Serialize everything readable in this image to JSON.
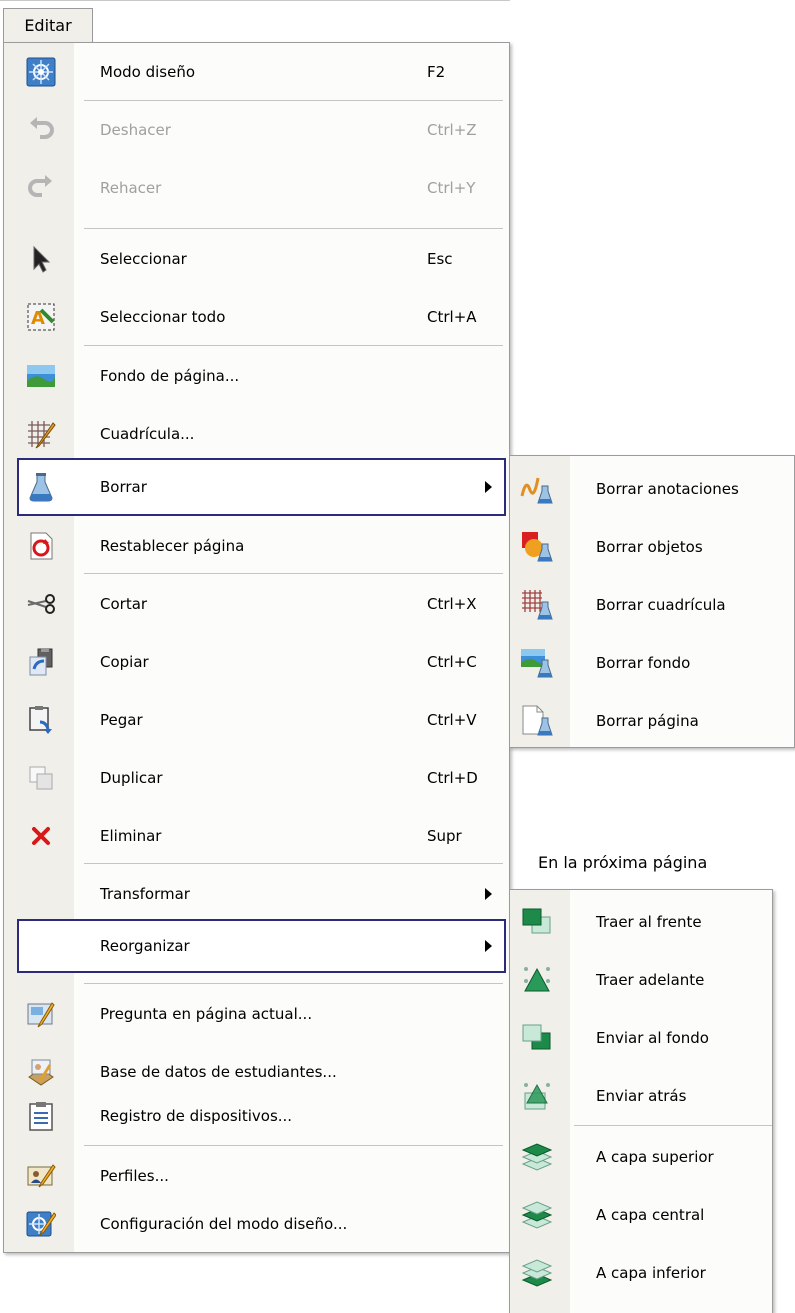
{
  "menubar": {
    "title": "Editar"
  },
  "main_menu": {
    "items": [
      {
        "label": "Modo diseño",
        "shortcut": "F2",
        "icon": "design-mode-icon"
      },
      {
        "label": "Deshacer",
        "shortcut": "Ctrl+Z",
        "icon": "undo-icon"
      },
      {
        "label": "Rehacer",
        "shortcut": "Ctrl+Y",
        "icon": "redo-icon"
      },
      {
        "label": "Seleccionar",
        "shortcut": "Esc",
        "icon": "pointer-icon"
      },
      {
        "label": "Seleccionar todo",
        "shortcut": "Ctrl+A",
        "icon": "select-all-icon"
      },
      {
        "label": "Fondo de página...",
        "shortcut": "",
        "icon": "page-background-icon"
      },
      {
        "label": "Cuadrícula...",
        "shortcut": "",
        "icon": "grid-icon"
      },
      {
        "label": "Borrar",
        "shortcut": "",
        "icon": "clear-icon"
      },
      {
        "label": "Restablecer página",
        "shortcut": "",
        "icon": "reset-page-icon"
      },
      {
        "label": "Cortar",
        "shortcut": "Ctrl+X",
        "icon": "scissors-icon"
      },
      {
        "label": "Copiar",
        "shortcut": "Ctrl+C",
        "icon": "copy-icon"
      },
      {
        "label": "Pegar",
        "shortcut": "Ctrl+V",
        "icon": "paste-icon"
      },
      {
        "label": "Duplicar",
        "shortcut": "Ctrl+D",
        "icon": "duplicate-icon"
      },
      {
        "label": "Eliminar",
        "shortcut": "Supr",
        "icon": "delete-icon"
      },
      {
        "label": "Transformar",
        "shortcut": "",
        "icon": ""
      },
      {
        "label": "Reorganizar",
        "shortcut": "",
        "icon": ""
      },
      {
        "label": "Pregunta en página actual...",
        "shortcut": "",
        "icon": "question-icon"
      },
      {
        "label": "Base de datos de estudiantes...",
        "shortcut": "",
        "icon": "student-database-icon"
      },
      {
        "label": "Registro de dispositivos...",
        "shortcut": "",
        "icon": "device-registry-icon"
      },
      {
        "label": "Perfiles...",
        "shortcut": "",
        "icon": "profiles-icon"
      },
      {
        "label": "Configuración del modo diseño...",
        "shortcut": "",
        "icon": "design-mode-settings-icon"
      }
    ]
  },
  "borrar_submenu": {
    "items": [
      {
        "label": "Borrar anotaciones",
        "icon": "clear-annotations-icon"
      },
      {
        "label": "Borrar objetos",
        "icon": "clear-objects-icon"
      },
      {
        "label": "Borrar cuadrícula",
        "icon": "clear-grid-icon"
      },
      {
        "label": "Borrar fondo",
        "icon": "clear-background-icon"
      },
      {
        "label": "Borrar página",
        "icon": "clear-page-icon"
      }
    ]
  },
  "note": "En la próxima página",
  "reorganizar_submenu": {
    "items": [
      {
        "label": "Traer al frente",
        "icon": "bring-to-front-icon"
      },
      {
        "label": "Traer adelante",
        "icon": "bring-forward-icon"
      },
      {
        "label": "Enviar al fondo",
        "icon": "send-to-back-icon"
      },
      {
        "label": "Enviar atrás",
        "icon": "send-backward-icon"
      },
      {
        "label": "A capa superior",
        "icon": "top-layer-icon"
      },
      {
        "label": "A capa central",
        "icon": "middle-layer-icon"
      },
      {
        "label": "A capa inferior",
        "icon": "bottom-layer-icon"
      }
    ]
  }
}
